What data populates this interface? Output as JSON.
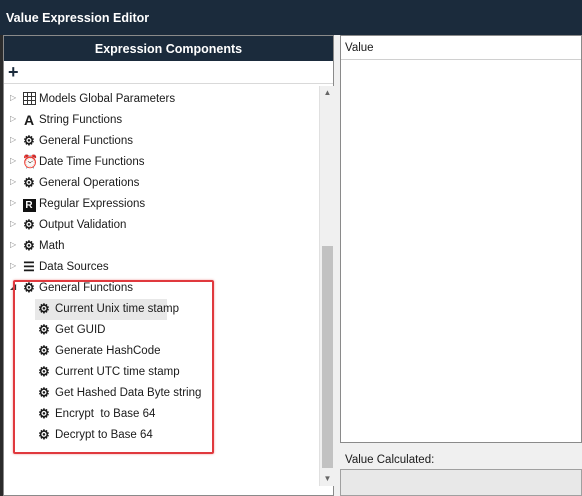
{
  "window": {
    "title": "Value Expression Editor"
  },
  "components": {
    "header": "Expression Components",
    "add_label": "+",
    "items": [
      {
        "label": "Models Global Parameters",
        "icon": "grid-icon"
      },
      {
        "label": "String Functions",
        "icon": "font-a-icon"
      },
      {
        "label": "General Functions",
        "icon": "gear-icon"
      },
      {
        "label": "Date Time Functions",
        "icon": "alarm-clock-icon"
      },
      {
        "label": "General Operations",
        "icon": "gear-icon"
      },
      {
        "label": "Regular Expressions",
        "icon": "r-icon"
      },
      {
        "label": "Output Validation",
        "icon": "gear-icon"
      },
      {
        "label": "Math",
        "icon": "gear-icon"
      },
      {
        "label": "Data Sources",
        "icon": "database-icon"
      },
      {
        "label": "General Functions",
        "icon": "gear-icon",
        "expanded": true
      }
    ],
    "children": [
      {
        "label": "Current Unix time stamp",
        "selected": true
      },
      {
        "label": "Get GUID"
      },
      {
        "label": "Generate HashCode"
      },
      {
        "label": "Current UTC time stamp"
      },
      {
        "label": "Get Hashed Data Byte string"
      },
      {
        "label": "Encrypt  to Base 64"
      },
      {
        "label": "Decrypt to Base 64"
      }
    ]
  },
  "value_panel": {
    "header": "Value"
  },
  "calculated": {
    "label": "Value Calculated:"
  },
  "colors": {
    "titlebar": "#1b2b3c",
    "highlight_box": "#e0393e"
  }
}
